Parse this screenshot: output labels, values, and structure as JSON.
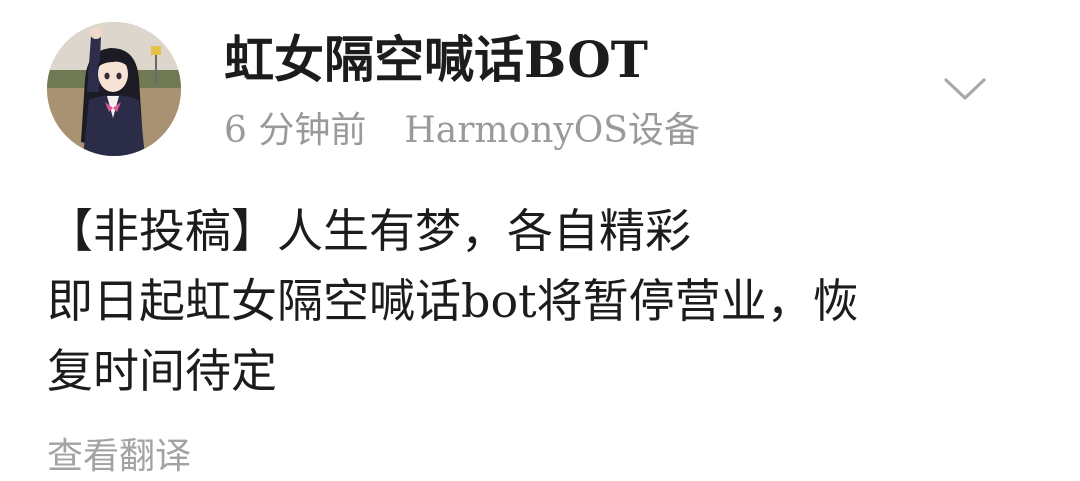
{
  "post": {
    "author": "虹女隔空喊话BOT",
    "timestamp": "6 分钟前",
    "device": "HarmonyOS设备",
    "menu_icon": "chevron-down-icon",
    "content_lines": [
      "【非投稿】人生有梦，各自精彩",
      "即日起虹女隔空喊话bot将暂停营业，恢",
      "复时间待定"
    ],
    "translate_label": "查看翻译"
  },
  "colors": {
    "text_primary": "#1c1c1c",
    "text_secondary": "#9a9a9a",
    "icon_gray": "#a8a8a8",
    "background": "#ffffff"
  }
}
